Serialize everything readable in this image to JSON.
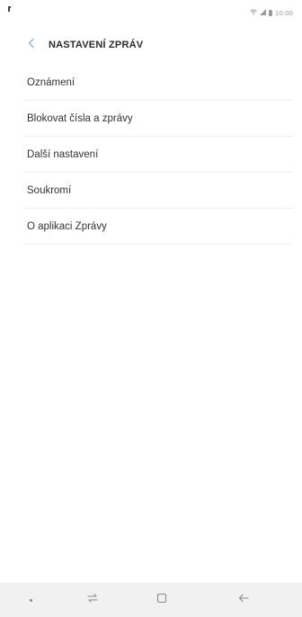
{
  "status_bar": {
    "time": "10:00",
    "icons": [
      "wifi-icon",
      "signal-icon",
      "battery-icon"
    ],
    "color": "#9a9a9a"
  },
  "header": {
    "title": "NASTAVENÍ ZPRÁV",
    "back_icon": "chevron-left-icon",
    "accent_color": "#8bb5c4"
  },
  "menu": {
    "items": [
      {
        "label": "Oznámení"
      },
      {
        "label": "Blokovat čísla a zprávy"
      },
      {
        "label": "Další nastavení"
      },
      {
        "label": "Soukromí"
      },
      {
        "label": "O aplikaci Zprávy"
      }
    ]
  },
  "nav_bar": {
    "buttons": [
      "dot-icon",
      "recent-apps-icon",
      "home-icon",
      "back-arrow-icon"
    ],
    "background": "#f1f1f1",
    "icon_color": "#8a8a8a"
  }
}
